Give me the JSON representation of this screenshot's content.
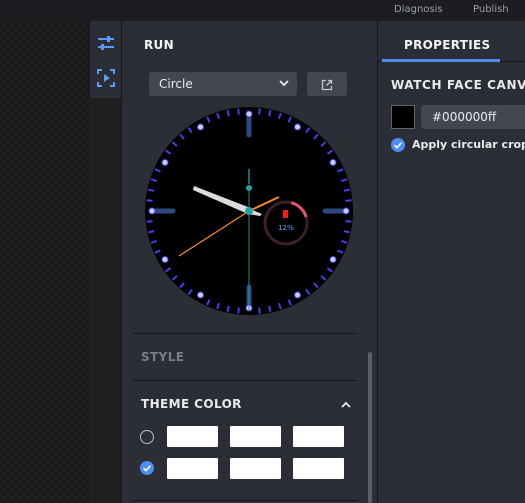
{
  "topbar": {
    "menu": [
      "Diagnosis",
      "Publish"
    ]
  },
  "toolbar": {
    "tools": [
      {
        "icon": "sliders-icon",
        "active": true
      },
      {
        "icon": "run-preview-icon",
        "active": false
      }
    ]
  },
  "run_panel": {
    "title": "RUN",
    "shape_select": {
      "value": "Circle"
    },
    "watch": {
      "battery_text": "12%",
      "battery_level": 0.12,
      "accent_colors": {
        "ticks": "#4a3df0",
        "hour_markers": "#2c4a80",
        "seconds": "#ff8a1f",
        "battery_arc": "#e8536f"
      }
    },
    "sections": {
      "style": "STYLE",
      "theme_color": "THEME COLOR"
    },
    "theme_options": [
      {
        "selected": false,
        "swatches": [
          "#ffffff",
          "#ffffff",
          "#ffffff"
        ]
      },
      {
        "selected": true,
        "swatches": [
          "#ffffff",
          "#ffffff",
          "#ffffff"
        ]
      }
    ]
  },
  "properties": {
    "tab": "PROPERTIES",
    "section_title": "WATCH FACE CANVAS",
    "background_color": "#000000ff",
    "apply_circular_crop": true,
    "crop_label": "Apply circular crop"
  },
  "colors": {
    "accent": "#4c8df6",
    "panel_bg": "#2b2e35",
    "input_bg": "#44474f"
  }
}
